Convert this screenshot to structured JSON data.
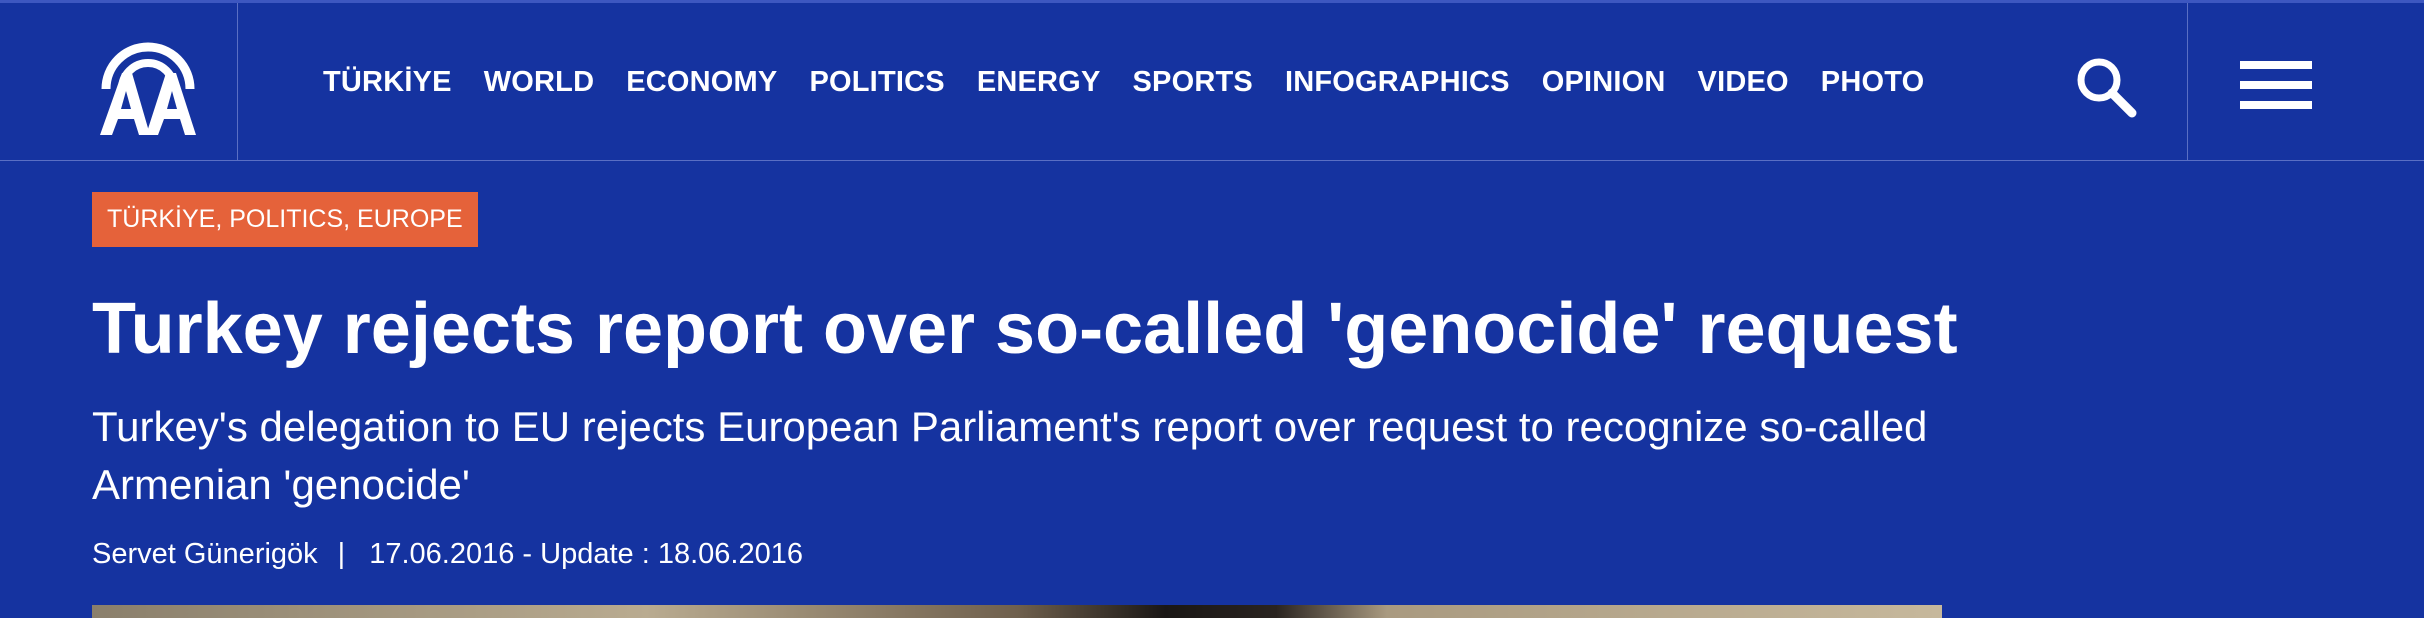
{
  "header": {
    "logo_text": "AA",
    "nav": [
      "TÜRKİYE",
      "WORLD",
      "ECONOMY",
      "POLITICS",
      "ENERGY",
      "SPORTS",
      "INFOGRAPHICS",
      "OPINION",
      "VIDEO",
      "PHOTO"
    ],
    "search_icon": "search-icon",
    "menu_icon": "hamburger-icon"
  },
  "article": {
    "categories": "TÜRKİYE, POLITICS, EUROPE",
    "title": "Turkey rejects report over so-called 'genocide' request",
    "subtitle": "Turkey's delegation to EU rejects European Parliament's report over request to recognize so-called Armenian 'genocide'",
    "author": "Servet Günerigök",
    "separator": "|",
    "dates": "17.06.2016 - Update : 18.06.2016"
  },
  "colors": {
    "background": "#1533a0",
    "tag": "#e5623a",
    "text": "#ffffff"
  }
}
